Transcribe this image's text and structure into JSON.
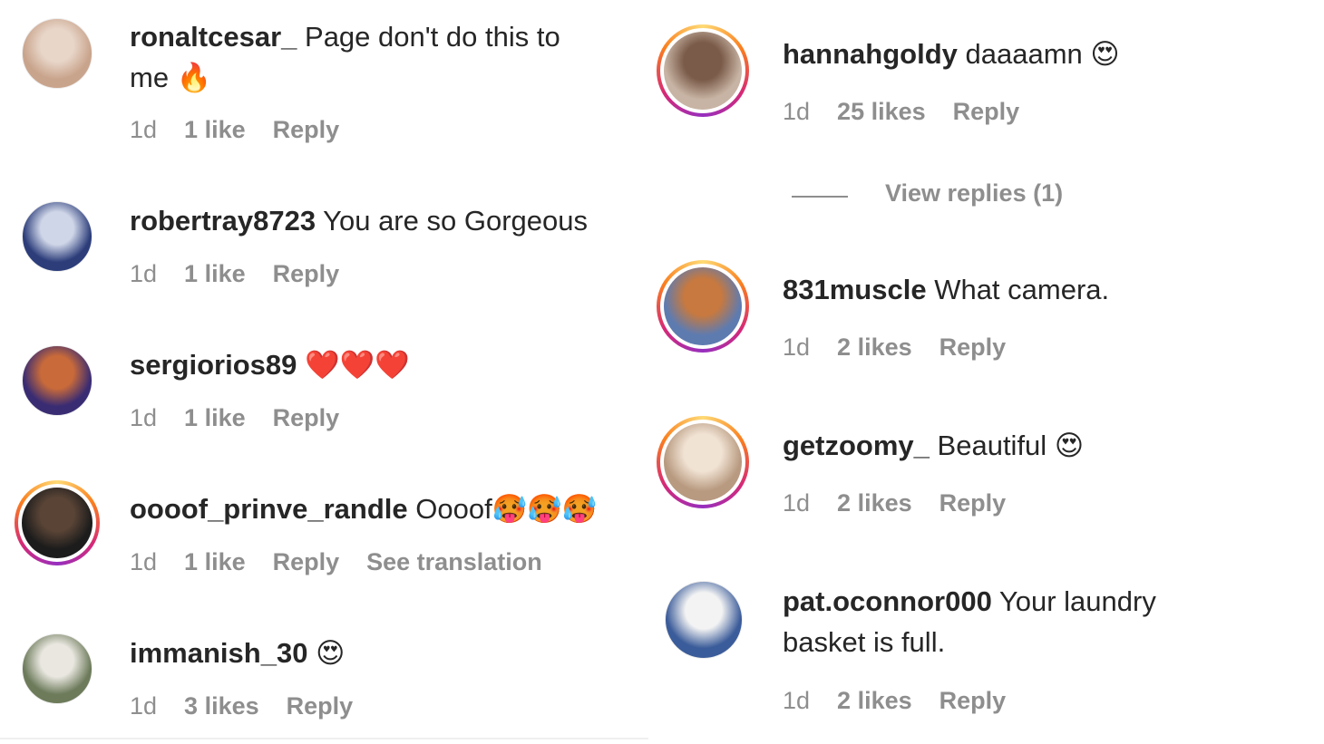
{
  "left": [
    {
      "user": "ronaltcesar_",
      "text": "Page don't do this to",
      "text2": "me",
      "emoji": "🔥",
      "time": "1d",
      "likes": "1 like",
      "reply": "Reply",
      "extra": "",
      "colors": [
        "#c9a48c",
        "#e8d6c9"
      ]
    },
    {
      "user": "robertray8723",
      "text": "You are so Gorgeous",
      "text2": "",
      "emoji": "",
      "time": "1d",
      "likes": "1 like",
      "reply": "Reply",
      "extra": "",
      "colors": [
        "#2c3d7a",
        "#cfd6e8"
      ]
    },
    {
      "user": "sergiorios89",
      "text": "",
      "text2": "",
      "emoji": "❤️❤️❤️",
      "time": "1d",
      "likes": "1 like",
      "reply": "Reply",
      "extra": "",
      "colors": [
        "#3a2c73",
        "#c86a3a"
      ]
    },
    {
      "user": "oooof_prinve_randle",
      "text": "Oooof",
      "text2": "",
      "emoji": "🥵🥵🥵",
      "time": "1d",
      "likes": "1 like",
      "reply": "Reply",
      "extra": "See translation",
      "colors": [
        "#1c1c1c",
        "#5a4436"
      ]
    },
    {
      "user": "immanish_30",
      "text": "",
      "text2": "",
      "emoji": "😍",
      "time": "1d",
      "likes": "3 likes",
      "reply": "Reply",
      "extra": "",
      "colors": [
        "#6d7b5b",
        "#e9e7e0"
      ]
    }
  ],
  "right": [
    {
      "user": "hannahgoldy",
      "text": "daaaamn",
      "text2": "",
      "emoji": "😍",
      "time": "1d",
      "likes": "25 likes",
      "reply": "Reply",
      "colors": [
        "#c8b4a4",
        "#7a5a48"
      ]
    },
    {
      "user": "831muscle",
      "text": "What camera.",
      "text2": "",
      "emoji": "",
      "time": "1d",
      "likes": "2 likes",
      "reply": "Reply",
      "colors": [
        "#5e7bb0",
        "#c7793f"
      ]
    },
    {
      "user": "getzoomy_",
      "text": "Beautiful",
      "text2": "",
      "emoji": "😍",
      "time": "1d",
      "likes": "2 likes",
      "reply": "Reply",
      "colors": [
        "#b89a80",
        "#f1e3d4"
      ]
    },
    {
      "user": "pat.oconnor000",
      "text": "Your laundry",
      "text2": "basket is full.",
      "emoji": "",
      "time": "1d",
      "likes": "2 likes",
      "reply": "Reply",
      "colors": [
        "#3b5c9a",
        "#f3f3f3"
      ]
    }
  ],
  "view_replies": "View replies (1)"
}
